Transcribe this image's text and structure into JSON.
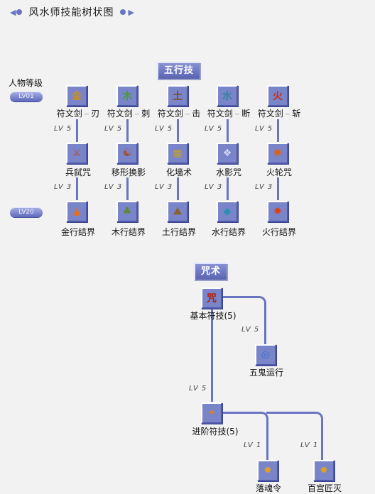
{
  "title": "风水师技能树状图",
  "sections": {
    "wuxing": "五行技",
    "zhoushu": "咒术"
  },
  "level_header": "人物等级",
  "level_badges": [
    "LV01",
    "LV20"
  ],
  "wuxing_columns": [
    {
      "top": {
        "name": "符文剑",
        "suffix": "刃",
        "icon": "rune-sword-metal-icon",
        "color": "#c8902a"
      },
      "req1": "LV 5",
      "mid": {
        "name": "兵弑咒",
        "icon": "blade-curse-icon",
        "color": "#b0502a"
      },
      "req2": "LV 3",
      "bottom": {
        "name": "金行结界",
        "icon": "metal-barrier-icon",
        "color": "#e07020"
      }
    },
    {
      "top": {
        "name": "符文剑",
        "suffix": "刺",
        "icon": "rune-sword-wood-icon",
        "color": "#4a9a3a"
      },
      "req1": "LV 5",
      "mid": {
        "name": "移形换影",
        "icon": "shadow-shift-icon",
        "color": "#a05040"
      },
      "req2": "LV 3",
      "bottom": {
        "name": "木行结界",
        "icon": "wood-barrier-icon",
        "color": "#5a8a30"
      }
    },
    {
      "top": {
        "name": "符文剑",
        "suffix": "击",
        "icon": "rune-sword-earth-icon",
        "color": "#7a4a20"
      },
      "req1": "LV 5",
      "mid": {
        "name": "化墙术",
        "icon": "wall-spell-icon",
        "color": "#c0a030"
      },
      "req2": "LV 3",
      "bottom": {
        "name": "土行结界",
        "icon": "earth-barrier-icon",
        "color": "#8a6030"
      }
    },
    {
      "top": {
        "name": "符文剑",
        "suffix": "断",
        "icon": "rune-sword-water-icon",
        "color": "#2a8aa0"
      },
      "req1": "LV 5",
      "mid": {
        "name": "水影咒",
        "icon": "water-shadow-icon",
        "color": "#d0d8f0"
      },
      "req2": "LV 3",
      "bottom": {
        "name": "水行结界",
        "icon": "water-barrier-icon",
        "color": "#2a90b0"
      }
    },
    {
      "top": {
        "name": "符文剑",
        "suffix": "斩",
        "icon": "rune-sword-fire-icon",
        "color": "#c03020"
      },
      "req1": "LV 5",
      "mid": {
        "name": "火轮咒",
        "icon": "fire-wheel-icon",
        "color": "#e06010"
      },
      "req2": "LV 3",
      "bottom": {
        "name": "火行结界",
        "icon": "fire-barrier-icon",
        "color": "#e04010"
      }
    }
  ],
  "zhoushu_tree": {
    "basic": {
      "name": "基本符技(5)",
      "icon": "basic-talisman-icon",
      "color": "#d0a030"
    },
    "req_ghost": "LV 5",
    "ghost": {
      "name": "五鬼运行",
      "icon": "five-ghosts-icon",
      "color": "#3a70c0"
    },
    "req_advanced": "LV 5",
    "advanced": {
      "name": "进阶符技(5)",
      "icon": "advanced-talisman-icon",
      "color": "#e08020"
    },
    "req_soul": "LV 1",
    "soul": {
      "name": "落魂令",
      "icon": "soul-fall-icon",
      "color": "#e0a020"
    },
    "req_craft": "LV 1",
    "craft": {
      "name": "百宫匠灭",
      "icon": "craft-destroy-icon",
      "color": "#e0a020"
    }
  }
}
